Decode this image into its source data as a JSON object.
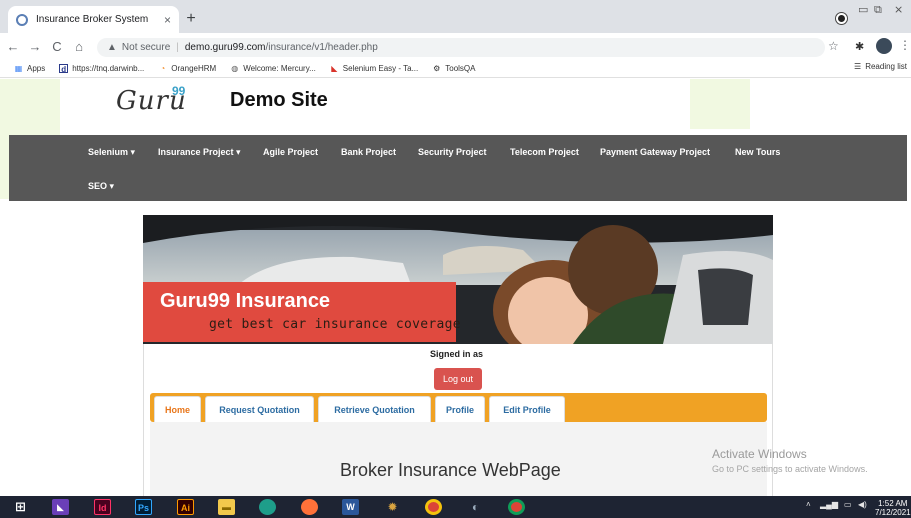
{
  "browser": {
    "tab_title": "Insurance Broker System",
    "tab_close": "×",
    "new_tab": "+",
    "nav_back": "←",
    "nav_forward": "→",
    "nav_reload": "C",
    "nav_home": "⌂",
    "security_label": "Not secure",
    "url_host": "demo.guru99.com",
    "url_path": "/insurance/v1/header.php",
    "bookmarks": [
      {
        "icon": "apps-icon",
        "label": "Apps"
      },
      {
        "icon": "d-icon",
        "label": "https://tnq.darwinb..."
      },
      {
        "icon": "orangehrm-icon",
        "label": "OrangeHRM"
      },
      {
        "icon": "globe-icon",
        "label": "Welcome: Mercury..."
      },
      {
        "icon": "selenium-icon",
        "label": "Selenium Easy - Ta..."
      },
      {
        "icon": "gear-icon",
        "label": "ToolsQA"
      }
    ],
    "reading_list": "Reading list"
  },
  "site": {
    "logo_text": "Guru",
    "logo_sup": "99",
    "title": "Demo Site",
    "menu": [
      "Selenium ▾",
      "Insurance Project ▾",
      "Agile Project",
      "Bank Project",
      "Security Project",
      "Telecom Project",
      "Payment Gateway Project",
      "New Tours",
      "SEO ▾"
    ]
  },
  "banner": {
    "brand": "Guru99 Insurance",
    "tagline": "get best car insurance coverage"
  },
  "account": {
    "signed_in": "Signed in as",
    "logout": "Log out"
  },
  "tabs": [
    "Home",
    "Request Quotation",
    "Retrieve Quotation",
    "Profile",
    "Edit Profile"
  ],
  "active_tab": "Home",
  "pane_heading": "Broker Insurance WebPage",
  "watermark": {
    "title": "Activate Windows",
    "subtitle": "Go to PC settings to activate Windows."
  },
  "taskbar": {
    "apps": [
      "Id",
      "Ps",
      "Ai",
      "W"
    ],
    "time": "1:52 AM",
    "date": "7/12/2021"
  },
  "colors": {
    "menubar": "#575757",
    "tabbar": "#f0a224",
    "logout": "#d9534f",
    "banner_label": "#e04a3f"
  }
}
